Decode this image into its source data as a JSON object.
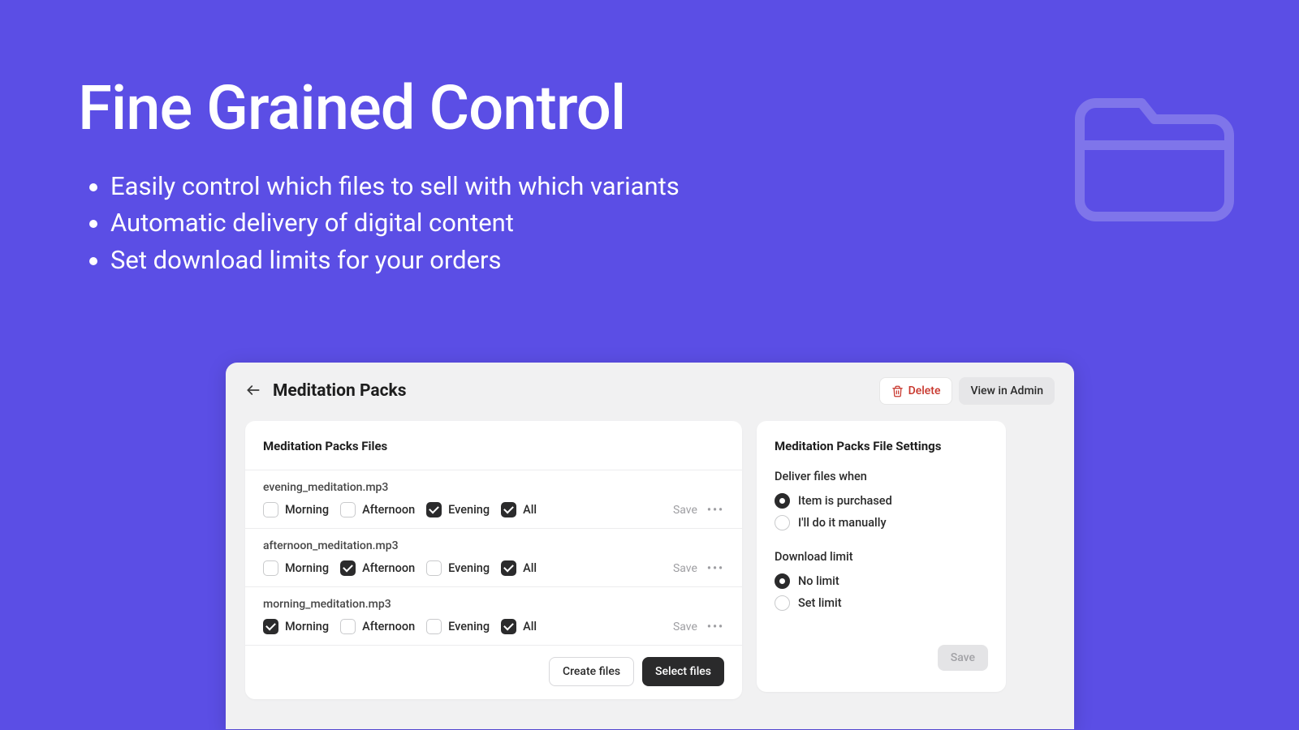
{
  "hero": {
    "title": "Fine Grained Control",
    "bullets": [
      "Easily control which files to sell with which variants",
      "Automatic delivery of digital content",
      "Set download limits for your orders"
    ]
  },
  "panel": {
    "title": "Meditation Packs",
    "delete_label": "Delete",
    "admin_label": "View in Admin",
    "files_card_title": "Meditation Packs Files",
    "variant_labels": [
      "Morning",
      "Afternoon",
      "Evening",
      "All"
    ],
    "save_label": "Save",
    "files": [
      {
        "name": "evening_meditation.mp3",
        "checks": [
          false,
          false,
          true,
          true
        ]
      },
      {
        "name": "afternoon_meditation.mp3",
        "checks": [
          false,
          true,
          false,
          true
        ]
      },
      {
        "name": "morning_meditation.mp3",
        "checks": [
          true,
          false,
          false,
          true
        ]
      }
    ],
    "create_files_label": "Create files",
    "select_files_label": "Select files",
    "settings_card_title": "Meditation Packs File Settings",
    "deliver_label": "Deliver files when",
    "deliver_options": [
      {
        "label": "Item is purchased",
        "selected": true
      },
      {
        "label": "I'll do it manually",
        "selected": false
      }
    ],
    "limit_label": "Download limit",
    "limit_options": [
      {
        "label": "No limit",
        "selected": true
      },
      {
        "label": "Set limit",
        "selected": false
      }
    ],
    "settings_save_label": "Save"
  }
}
